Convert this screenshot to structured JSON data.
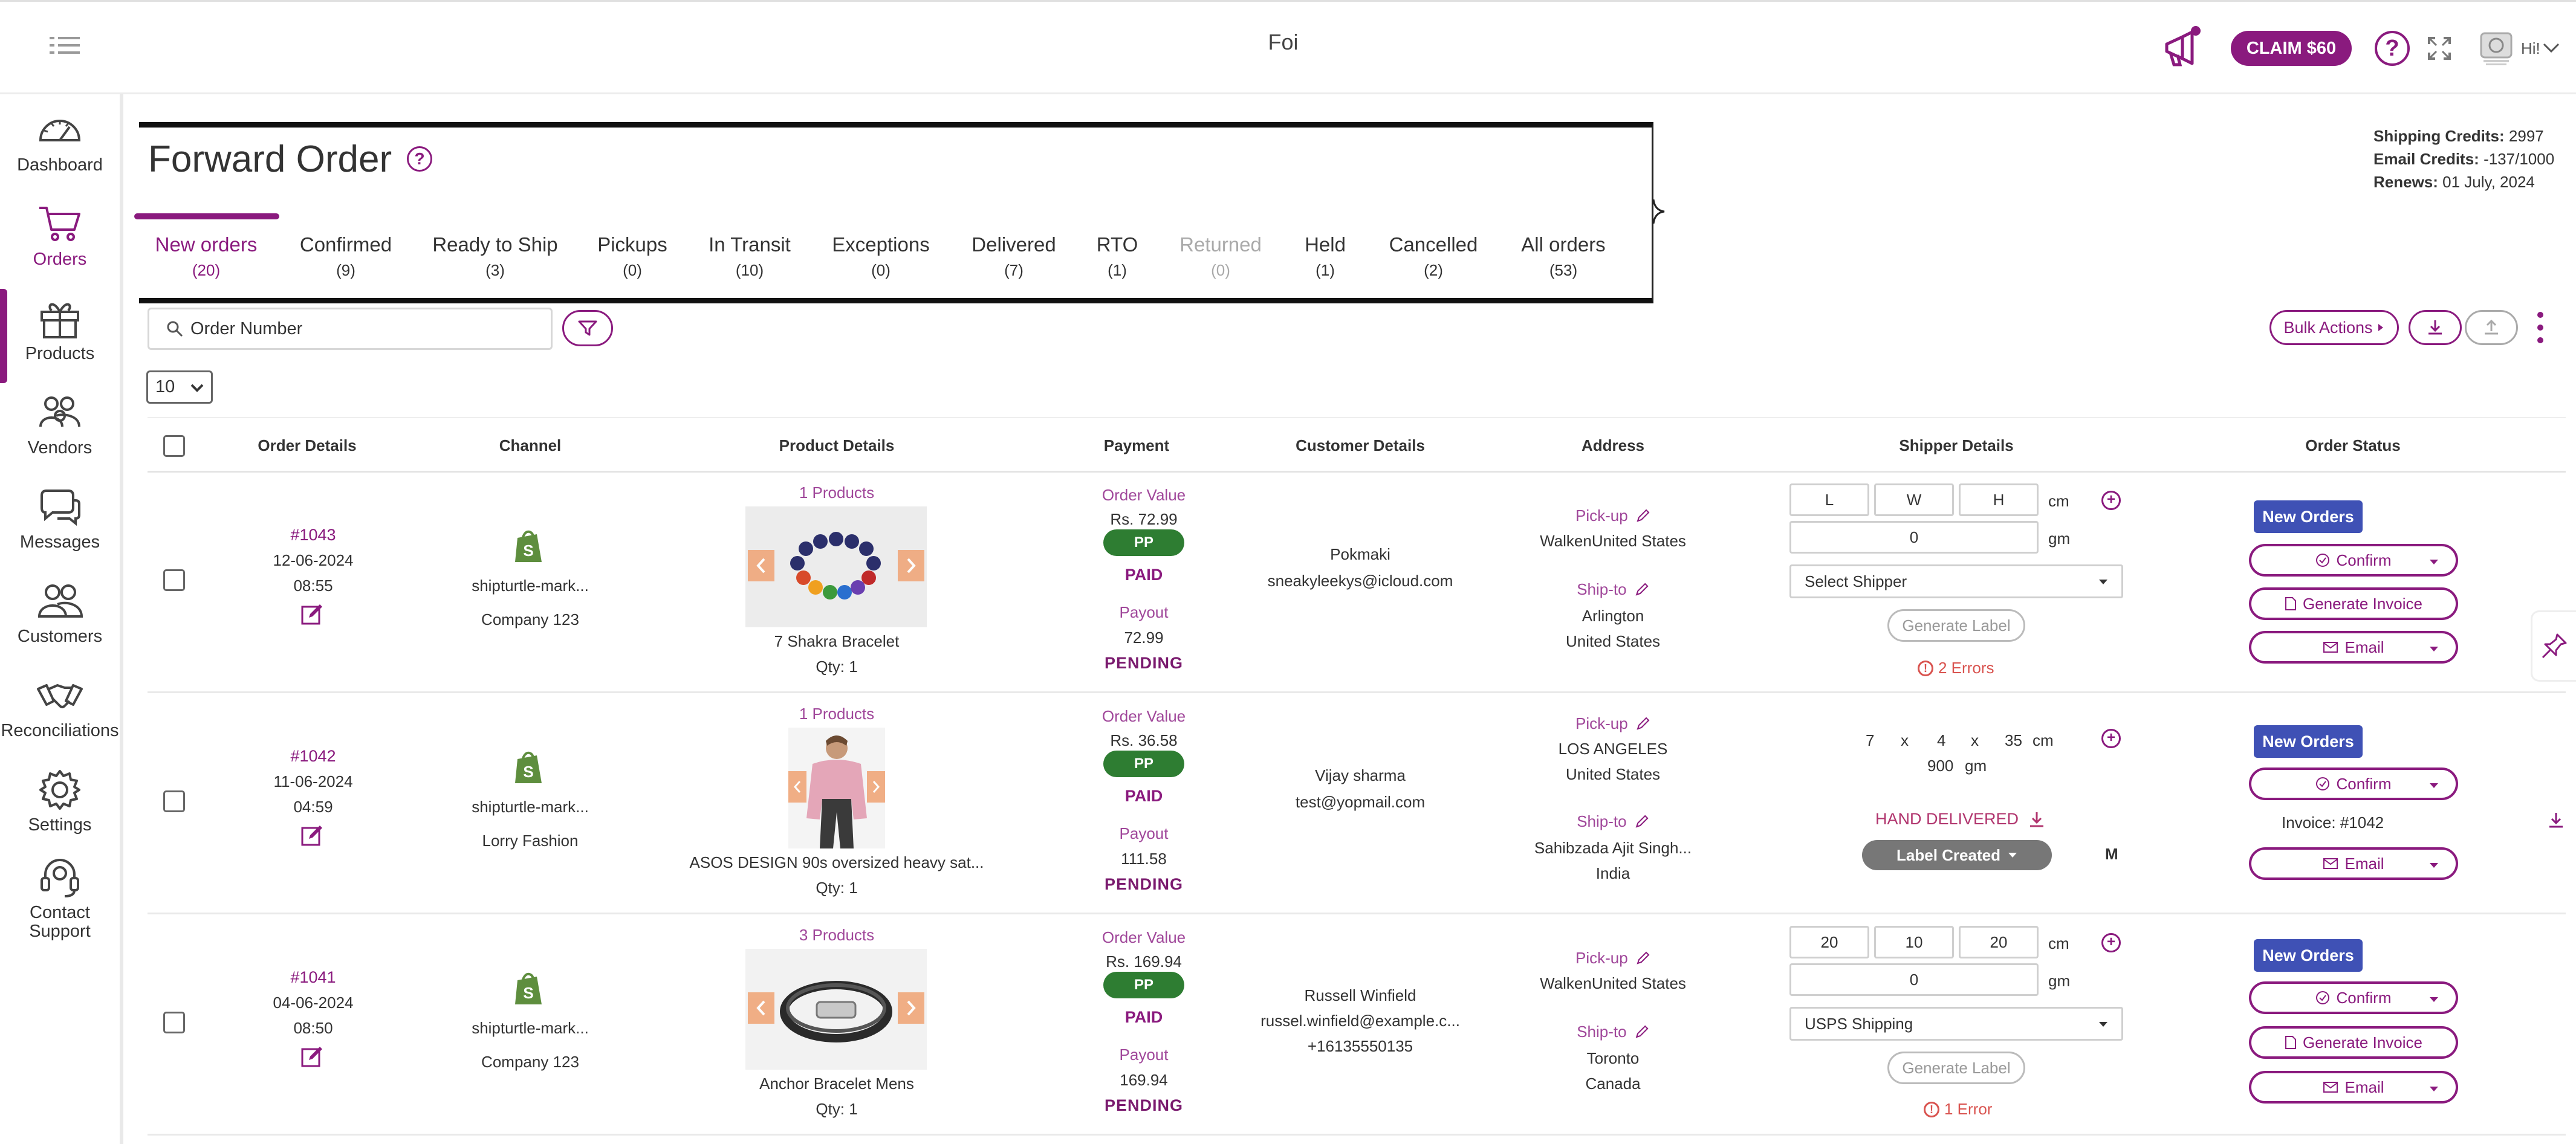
{
  "app": {
    "title": "Foi",
    "claim_label": "CLAIM $60",
    "help_label": "?",
    "greeting": "Hi!"
  },
  "sidebar": {
    "items": [
      {
        "label": "Dashboard",
        "icon": "speedometer-icon"
      },
      {
        "label": "Orders",
        "icon": "cart-icon"
      },
      {
        "label": "Products",
        "icon": "gift-box-icon"
      },
      {
        "label": "Vendors",
        "icon": "users-group-icon"
      },
      {
        "label": "Messages",
        "icon": "chat-icon"
      },
      {
        "label": "Customers",
        "icon": "customers-icon"
      },
      {
        "label": "Reconciliations",
        "icon": "handshake-icon"
      },
      {
        "label": "Settings",
        "icon": "gear-icon"
      },
      {
        "label": "Contact\nSupport",
        "icon": "headset-icon"
      }
    ]
  },
  "page": {
    "title": "Forward Order",
    "help": "?"
  },
  "tabs": [
    {
      "label": "New orders",
      "count": "(20)"
    },
    {
      "label": "Confirmed",
      "count": "(9)"
    },
    {
      "label": "Ready to Ship",
      "count": "(3)"
    },
    {
      "label": "Pickups",
      "count": "(0)"
    },
    {
      "label": "In Transit",
      "count": "(10)"
    },
    {
      "label": "Exceptions",
      "count": "(0)"
    },
    {
      "label": "Delivered",
      "count": "(7)"
    },
    {
      "label": "RTO",
      "count": "(1)"
    },
    {
      "label": "Returned",
      "count": "(0)"
    },
    {
      "label": "Held",
      "count": "(1)"
    },
    {
      "label": "Cancelled",
      "count": "(2)"
    },
    {
      "label": "All orders",
      "count": "(53)"
    }
  ],
  "credits": {
    "shipping_label": "Shipping Credits:",
    "shipping_value": "2997",
    "email_label": "Email Credits:",
    "email_value": "-137/1000",
    "renews_label": "Renews:",
    "renews_value": "01 July, 2024"
  },
  "toolbar": {
    "search_placeholder": "Order Number",
    "bulk_label": "Bulk Actions",
    "page_size": "10"
  },
  "table": {
    "headers": [
      "Order Details",
      "Channel",
      "Product Details",
      "Payment",
      "Customer Details",
      "Address",
      "Shipper Details",
      "Order Status"
    ],
    "rows": [
      {
        "order_number": "#1043",
        "date": "12-06-2024",
        "time": "08:55",
        "channel_name": "shipturtle-mark...",
        "company": "Company 123",
        "products_count": "1 Products",
        "product_name": "7 Shakra Bracelet",
        "qty": "Qty: 1",
        "order_value_label": "Order Value",
        "order_value": "Rs. 72.99",
        "badge": "PP",
        "paid": "PAID",
        "payout_label": "Payout",
        "payout": "72.99",
        "payout_status": "PENDING",
        "customer_name": "Pokmaki",
        "customer_email": "sneakyleekys@icloud.com",
        "customer_phone": "",
        "pickup_label": "Pick-up",
        "pickup_line1": "WalkenUnited States",
        "pickup_line2": "",
        "shipto_label": "Ship-to",
        "shipto_line1": "Arlington",
        "shipto_line2": "United States",
        "dim_l": "L",
        "dim_w": "W",
        "dim_h": "H",
        "unit_len": "cm",
        "weight": "0",
        "unit_wt": "gm",
        "shipper": "Select Shipper",
        "gen_label": "Generate Label",
        "errors": "2 Errors",
        "status": "New Orders",
        "confirm": "Confirm",
        "invoice": "Generate Invoice",
        "email": "Email"
      },
      {
        "order_number": "#1042",
        "date": "11-06-2024",
        "time": "04:59",
        "channel_name": "shipturtle-mark...",
        "company": "Lorry Fashion",
        "products_count": "1 Products",
        "product_name": "ASOS DESIGN 90s oversized heavy sat...",
        "qty": "Qty: 1",
        "order_value_label": "Order Value",
        "order_value": "Rs. 36.58",
        "badge": "PP",
        "paid": "PAID",
        "payout_label": "Payout",
        "payout": "111.58",
        "payout_status": "PENDING",
        "customer_name": "Vijay sharma",
        "customer_email": "test@yopmail.com",
        "customer_phone": "",
        "pickup_label": "Pick-up",
        "pickup_line1": "LOS ANGELES",
        "pickup_line2": "United States",
        "shipto_label": "Ship-to",
        "shipto_line1": "Sahibzada Ajit Singh...",
        "shipto_line2": "India",
        "dim_l": "7",
        "x1": "x",
        "dim_w": "4",
        "x2": "x",
        "dim_h": "35",
        "unit_len": "cm",
        "weight": "900",
        "unit_wt": "gm",
        "hand_delivered": "HAND DELIVERED",
        "label_created": "Label Created",
        "m_label": "M",
        "status": "New Orders",
        "confirm": "Confirm",
        "invoice_text": "Invoice: #1042",
        "email": "Email"
      },
      {
        "order_number": "#1041",
        "date": "04-06-2024",
        "time": "08:50",
        "channel_name": "shipturtle-mark...",
        "company": "Company 123",
        "products_count": "3 Products",
        "product_name": "Anchor Bracelet Mens",
        "qty": "Qty: 1",
        "order_value_label": "Order Value",
        "order_value": "Rs. 169.94",
        "badge": "PP",
        "paid": "PAID",
        "payout_label": "Payout",
        "payout": "169.94",
        "payout_status": "PENDING",
        "customer_name": "Russell Winfield",
        "customer_email": "russel.winfield@example.c...",
        "customer_phone": "+16135550135",
        "pickup_label": "Pick-up",
        "pickup_line1": "WalkenUnited States",
        "pickup_line2": "",
        "shipto_label": "Ship-to",
        "shipto_line1": "Toronto",
        "shipto_line2": "Canada",
        "dim_l": "20",
        "dim_w": "10",
        "dim_h": "20",
        "unit_len": "cm",
        "weight": "0",
        "unit_wt": "gm",
        "shipper": "USPS Shipping",
        "gen_label": "Generate Label",
        "errors": "1 Error",
        "status": "New Orders",
        "confirm": "Confirm",
        "invoice": "Generate Invoice",
        "email": "Email"
      }
    ]
  },
  "colors": {
    "brand": "#8a1a7e",
    "status_new": "#3f51b5",
    "paid_badge": "#2e7d32",
    "error": "#d9534f"
  }
}
